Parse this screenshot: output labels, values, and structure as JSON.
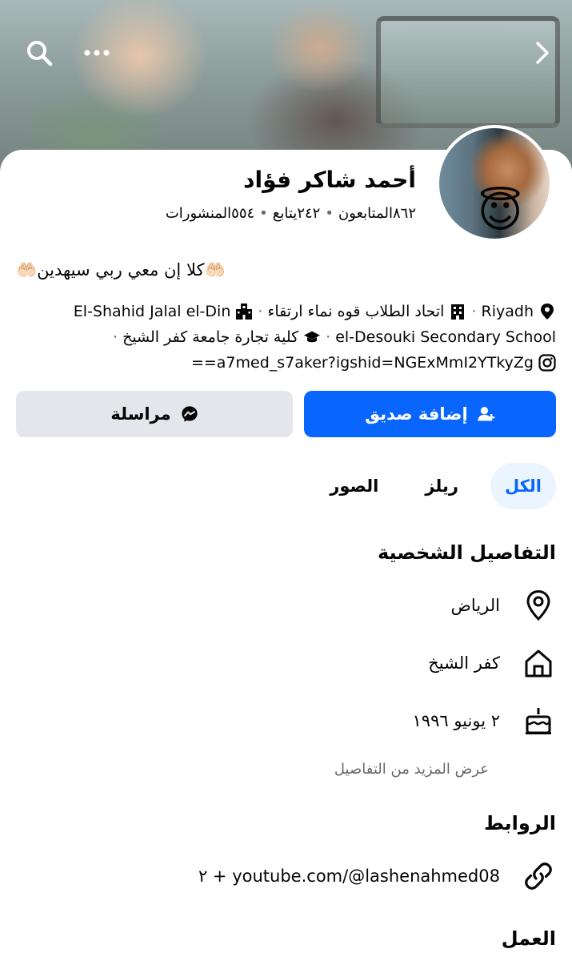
{
  "cover": {
    "search_icon": "search-icon",
    "more_icon": "more-horizontal-icon",
    "forward_icon": "chevron-right-icon"
  },
  "profile": {
    "name": "أحمد شاكر فؤاد",
    "followers": "٨٦٢المتابعون",
    "following": "٢٤٢يتابع",
    "posts": "٥٥٤المنشورات",
    "separator": "•",
    "avatar_badge": "😇",
    "bio": "🤲🏻كلا إن معي ربي سيهدين🤲🏻"
  },
  "intro": {
    "location": "Riyadh",
    "work1": "اتحاد الطلاب قوه نماء ارتقاء",
    "work2": "El-Shahid Jalal el-Din",
    "school": "el-Desouki Secondary School",
    "college": "كلية تجارة جامعة كفر الشيخ",
    "instagram": "a7med_s7aker?igshid=NGExMmI2YTkyZg==",
    "dot": "·"
  },
  "actions": {
    "add_friend": "إضافة صديق",
    "message": "مراسلة"
  },
  "tabs": [
    {
      "label": "الكل",
      "active": true
    },
    {
      "label": "ريلز",
      "active": false
    },
    {
      "label": "الصور",
      "active": false
    }
  ],
  "details": {
    "title": "التفاصيل الشخصية",
    "lives_in": "الرياض",
    "from": "كفر الشيخ",
    "birthday": "٢ يونيو ١٩٩٦",
    "see_more": "عرض المزيد من التفاصيل"
  },
  "links": {
    "title": "الروابط",
    "primary": "youtube.com/@lashenahmed08",
    "extra": "٢ +"
  },
  "work": {
    "title": "العمل"
  },
  "colors": {
    "accent": "#0866ff",
    "secondary_button": "#e4e6eb",
    "muted_text": "#65676b"
  }
}
